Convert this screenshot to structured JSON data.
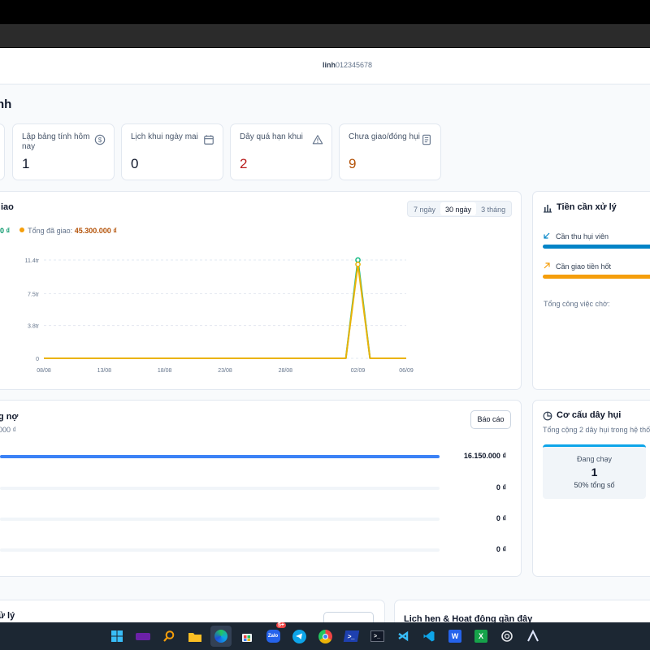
{
  "header": {
    "username": "linh",
    "phone": "012345678"
  },
  "page": {
    "title": "nh"
  },
  "stats": [
    {
      "label": "Lập bảng tính hôm nay",
      "value": "1",
      "icon": "dollar-circle-icon",
      "color": "#0f172a"
    },
    {
      "label": "Lịch khui ngày mai",
      "value": "0",
      "icon": "calendar-icon",
      "color": "#0f172a"
    },
    {
      "label": "Dây quá hạn khui",
      "value": "2",
      "icon": "warning-triangle-icon",
      "color": "#b91c1c"
    },
    {
      "label": "Chưa giao/đóng hụi",
      "value": "9",
      "icon": "document-icon",
      "color": "#b45309"
    }
  ],
  "chart_panel": {
    "title": "iao",
    "ranges": [
      "7 ngày",
      "30 ngày",
      "3 tháng"
    ],
    "active_range": "30 ngày",
    "legend_left_value": "0 ₫",
    "legend_right_label": "Tổng đã giao:",
    "legend_right_value": "45.300.000 ₫"
  },
  "chart_data": {
    "type": "line",
    "x_tick_labels": [
      "08/08",
      "13/08",
      "18/08",
      "23/08",
      "28/08",
      "02/09",
      "06/09"
    ],
    "y_tick_labels": [
      "0",
      "3.8tr",
      "7.5tr",
      "11.4tr"
    ],
    "ylim": [
      0,
      11.4
    ],
    "y_unit": "tr",
    "grid": true,
    "series": [
      {
        "color": "#10b981",
        "x": [
          "01/09",
          "02/09",
          "03/09"
        ],
        "values": [
          0,
          11.4,
          0
        ]
      },
      {
        "color": "#eab308",
        "x": [
          "08/08",
          "01/09",
          "02/09",
          "03/09",
          "06/09"
        ],
        "values": [
          0,
          0,
          10.9,
          0,
          0
        ]
      }
    ]
  },
  "side_panel": {
    "title": "Tiền cần xử lý",
    "items": [
      {
        "label": "Cần thu hụi viên",
        "color": "#0284c7"
      },
      {
        "label": "Cần giao tiền hốt",
        "color": "#f59e0b"
      }
    ],
    "footer": "Tổng công việc chờ:"
  },
  "debt_panel": {
    "title": "g nợ",
    "subtitle": "000 ₫",
    "report_button": "Báo cáo",
    "rows": [
      {
        "value": "16.150.000 ₫",
        "fill": 1.0
      },
      {
        "value": "0 ₫",
        "fill": 0
      },
      {
        "value": "0 ₫",
        "fill": 0
      },
      {
        "value": "0 ₫",
        "fill": 0
      }
    ]
  },
  "structure_panel": {
    "title": "Cơ cấu dây hụi",
    "subtitle": "Tổng cộng 2 dây hụi trong hệ thố",
    "box_label": "Đang chạy",
    "box_value": "1",
    "box_note": "50% tổng số"
  },
  "bottom": {
    "left_title": "ử lý",
    "right_title": "Lịch hẹn & Hoạt động gần đây"
  },
  "taskbar": {
    "items": [
      "windows-start-icon",
      "yahoo-icon",
      "search-icon",
      "file-explorer-icon",
      "edge-icon",
      "store-icon",
      "zalo-icon",
      "telegram-icon",
      "chrome-icon",
      "powershell-icon",
      "terminal-icon",
      "visual-studio-icon",
      "vscode-icon",
      "word-icon",
      "excel-icon",
      "chatgpt-icon",
      "antigravity-icon"
    ],
    "zalo_badge": "5+"
  }
}
